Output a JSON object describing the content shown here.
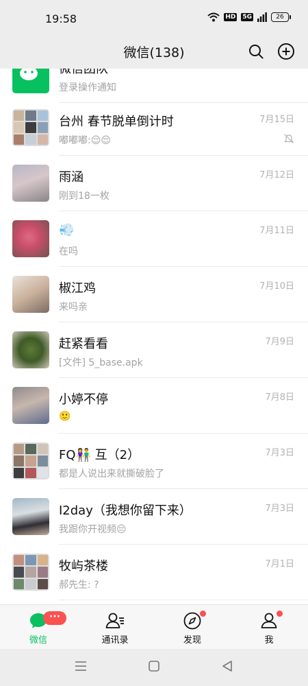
{
  "status": {
    "time": "19:58",
    "hd": "HD",
    "net": "5G",
    "battery": "26"
  },
  "header": {
    "title": "微信(138)",
    "search_icon": "search-icon",
    "add_icon": "plus-circle-icon"
  },
  "chats": [
    {
      "name": "微信团队",
      "message": "登录操作通知",
      "date": ""
    },
    {
      "name": "台州 春节脱单倒计时",
      "message": "嘟嘟嘟:😌😌",
      "date": "7月15日",
      "muted": true
    },
    {
      "name": "雨涵",
      "message": "刚到18一枚",
      "date": "7月12日"
    },
    {
      "name": "💨",
      "message": "在吗",
      "date": "7月11日"
    },
    {
      "name": "椒江鸡",
      "message": "来吗亲",
      "date": "7月10日"
    },
    {
      "name": "赶紧看看",
      "message": "[文件] 5_base.apk",
      "date": "7月9日"
    },
    {
      "name": "小婷不停",
      "message": "🙂",
      "date": "7月8日"
    },
    {
      "name": "FQ👫 互（2）",
      "message": "都是人说出来就撕破脸了",
      "date": "7月3日"
    },
    {
      "name": "I2day（我想你留下来）",
      "message": "我跟你开视频😔",
      "date": "7月3日"
    },
    {
      "name": "牧屿茶楼",
      "message": "郝先生: ?",
      "date": "7月1日"
    }
  ],
  "tabs": [
    {
      "label": "微信",
      "badge": "···"
    },
    {
      "label": "通讯录"
    },
    {
      "label": "发现"
    },
    {
      "label": "我"
    }
  ],
  "colors": {
    "accent": "#07c160",
    "badge": "#fa5151"
  }
}
